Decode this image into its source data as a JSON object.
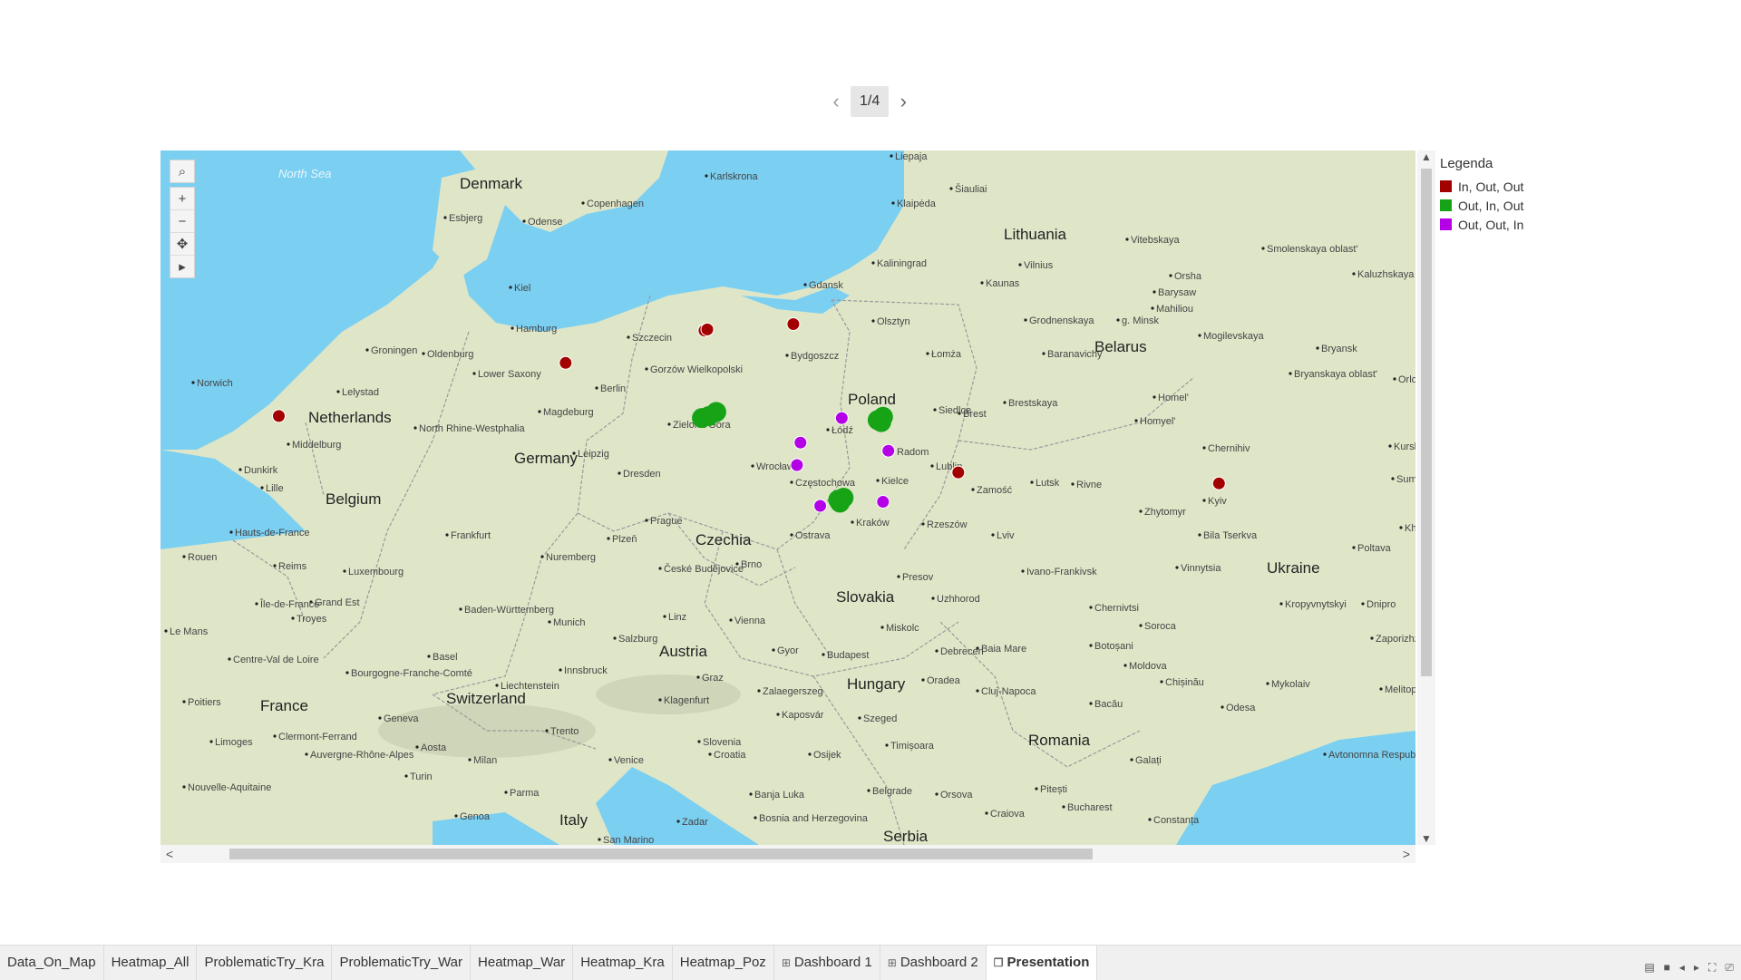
{
  "pager": {
    "prev": "‹",
    "label": "1/4",
    "next": "›"
  },
  "map": {
    "colors": {
      "water": "#7bcff1",
      "land": "#dfe6c8",
      "border": "#9a9a9a",
      "road": "#f2e3a3"
    },
    "labels": {
      "seas": [
        "North Sea"
      ],
      "countries": [
        "Denmark",
        "Lithuania",
        "Belarus",
        "Netherlands",
        "Poland",
        "Germany",
        "Belgium",
        "Czechia",
        "Ukraine",
        "Slovakia",
        "France",
        "Austria",
        "Switzerland",
        "Hungary",
        "Romania",
        "Italy",
        "Serbia"
      ],
      "cities": [
        "Karlskrona",
        "Copenhagen",
        "Esbjerg",
        "Odense",
        "Kiel",
        "Hamburg",
        "Groningen",
        "Oldenburg",
        "Lower Saxony",
        "Szczecin",
        "Gorzów Wielkopolski",
        "Berlin",
        "Bydgoszcz",
        "Gdansk",
        "Kaliningrad",
        "Klaipėda",
        "Liepaja",
        "Šiauliai",
        "Vilnius",
        "Kaunas",
        "Olsztyn",
        "Łomża",
        "Grodnenskaya",
        "g. Minsk",
        "Barysaw",
        "Baranavichy",
        "Brestskaya",
        "Brest",
        "Norwich",
        "Lelystad",
        "Middelburg",
        "Magdeburg",
        "North Rhine-Westphalia",
        "Leipzig",
        "Dresden",
        "Zielona Góra",
        "Łódź",
        "Siedlce",
        "Radom",
        "Lublin",
        "Wrocław",
        "Częstochowa",
        "Kielce",
        "Zamość",
        "Lutsk",
        "Rivne",
        "Zhytomyr",
        "Kyiv",
        "Bila Tserkva",
        "Chernihiv",
        "Homel'",
        "Mogilevskaya",
        "Vitebskaya",
        "Smolenskaya oblast'",
        "Kaluzhskaya oblast'",
        "Bryansk",
        "Bryanskaya oblast'",
        "Orsha",
        "Mahiliou",
        "Homyel'",
        "Dunkirk",
        "Lille",
        "Hauts-de-France",
        "Rouen",
        "Reims",
        "Grand Est",
        "Frankfurt",
        "Nuremberg",
        "Prague",
        "Plzeň",
        "České Budějovice",
        "Brno",
        "Ostrava",
        "Kraków",
        "Rzeszów",
        "Lviv",
        "Ivano-Frankivsk",
        "Chernivtsi",
        "Vinnytsia",
        "Kropyvnytskyi",
        "Dnipro",
        "Zaporizhzhia",
        "Poltava",
        "Sumy",
        "Kha",
        "Presov",
        "Uzhhorod",
        "Miskolc",
        "Baia Mare",
        "Cluj-Napoca",
        "Oradea",
        "Debrecen",
        "Budapest",
        "Gyor",
        "Vienna",
        "Linz",
        "Salzburg",
        "Munich",
        "Baden-Württemberg",
        "Innsbruck",
        "Graz",
        "Liechtenstein",
        "Klagenfurt",
        "Zalaegerszeg",
        "Kaposvár",
        "Szeged",
        "Timișoara",
        "Osijek",
        "Belgrade",
        "Orsova",
        "Craiova",
        "Pitești",
        "Bucharest",
        "Constanța",
        "Galați",
        "Bacău",
        "Botoșani",
        "Soroca",
        "Moldova",
        "Chișinău",
        "Mykolaiv",
        "Odesa",
        "Melitopol",
        "Avtonomna Respublika Krym",
        "Basel",
        "Bourgogne-Franche-Comté",
        "Centre-Val de Loire",
        "Île-de-France",
        "Troyes",
        "Le Mans",
        "Poitiers",
        "Limoges",
        "Clermont-Ferrand",
        "Nouvelle-Aquitaine",
        "Auvergne-Rhône-Alpes",
        "Geneva",
        "Aosta",
        "Turin",
        "Milan",
        "Trento",
        "Venice",
        "Parma",
        "Genoa",
        "Slovenia",
        "Croatia",
        "Banja Luka",
        "Bosnia and Herzegovina",
        "Zadar",
        "San Marino",
        "Luxembourg",
        "Kurskobla",
        "Orlo ob"
      ]
    },
    "legend": {
      "title": "Legenda",
      "items": [
        {
          "label": "In, Out, Out",
          "color": "#a30000"
        },
        {
          "label": "Out, In, Out",
          "color": "#16a316"
        },
        {
          "label": "Out, Out, In",
          "color": "#b300e6"
        }
      ]
    },
    "points": [
      {
        "lat": 54.19,
        "lon": 16.17,
        "category": "In, Out, Out"
      },
      {
        "lat": 54.22,
        "lon": 16.25,
        "category": "In, Out, Out"
      },
      {
        "lat": 54.35,
        "lon": 18.65,
        "category": "In, Out, Out"
      },
      {
        "lat": 53.4,
        "lon": 12.3,
        "category": "In, Out, Out"
      },
      {
        "lat": 52.1,
        "lon": 4.3,
        "category": "In, Out, Out"
      },
      {
        "lat": 50.72,
        "lon": 23.25,
        "category": "In, Out, Out"
      },
      {
        "lat": 50.45,
        "lon": 30.52,
        "category": "In, Out, Out"
      },
      {
        "lat": 52.1,
        "lon": 16.3,
        "category": "Out, In, Out"
      },
      {
        "lat": 52.2,
        "lon": 16.5,
        "category": "Out, In, Out"
      },
      {
        "lat": 52.05,
        "lon": 16.1,
        "category": "Out, In, Out"
      },
      {
        "lat": 52.0,
        "lon": 21.0,
        "category": "Out, In, Out"
      },
      {
        "lat": 52.08,
        "lon": 21.15,
        "category": "Out, In, Out"
      },
      {
        "lat": 51.95,
        "lon": 21.1,
        "category": "Out, In, Out"
      },
      {
        "lat": 50.05,
        "lon": 19.9,
        "category": "Out, In, Out"
      },
      {
        "lat": 50.1,
        "lon": 20.05,
        "category": "Out, In, Out"
      },
      {
        "lat": 49.98,
        "lon": 19.95,
        "category": "Out, In, Out"
      },
      {
        "lat": 52.05,
        "lon": 20.0,
        "category": "Out, Out, In"
      },
      {
        "lat": 51.45,
        "lon": 18.85,
        "category": "Out, Out, In"
      },
      {
        "lat": 50.9,
        "lon": 18.75,
        "category": "Out, Out, In"
      },
      {
        "lat": 51.25,
        "lon": 21.3,
        "category": "Out, Out, In"
      },
      {
        "lat": 49.9,
        "lon": 19.4,
        "category": "Out, Out, In"
      },
      {
        "lat": 50.0,
        "lon": 21.15,
        "category": "Out, Out, In"
      }
    ],
    "controls": {
      "search": "⌕",
      "zoom_in": "+",
      "zoom_out": "−",
      "pan": "✥",
      "expand": "▸"
    }
  },
  "scroll": {
    "up": "▲",
    "down": "▼",
    "left": "<",
    "right": ">"
  },
  "tabs": [
    {
      "label": "Data_On_Map",
      "icon": ""
    },
    {
      "label": "Heatmap_All",
      "icon": ""
    },
    {
      "label": "ProblematicTry_Kra",
      "icon": ""
    },
    {
      "label": "ProblematicTry_War",
      "icon": ""
    },
    {
      "label": "Heatmap_War",
      "icon": ""
    },
    {
      "label": "Heatmap_Kra",
      "icon": ""
    },
    {
      "label": "Heatmap_Poz",
      "icon": ""
    },
    {
      "label": "Dashboard 1",
      "icon": "⊞"
    },
    {
      "label": "Dashboard 2",
      "icon": "⊞"
    },
    {
      "label": "Presentation",
      "icon": "❒"
    }
  ],
  "bottom_controls": [
    "▤",
    "■",
    "◂",
    "▸",
    "⛶",
    "⎚"
  ]
}
